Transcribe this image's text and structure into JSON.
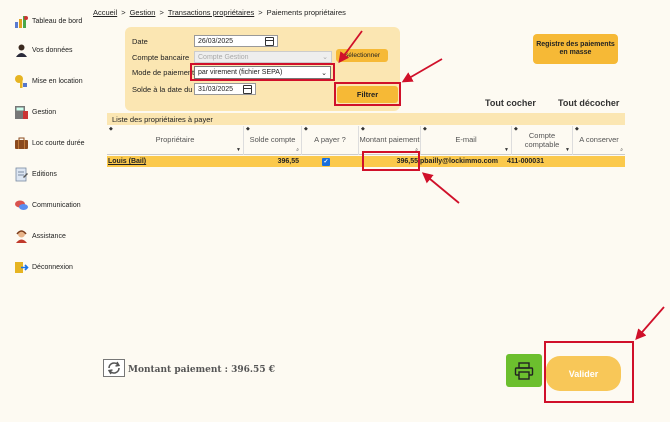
{
  "sidebar": {
    "items": [
      {
        "label": "Tableau de bord",
        "icon": "dashboard-icon"
      },
      {
        "label": "Vos données",
        "icon": "user-icon"
      },
      {
        "label": "Mise en location",
        "icon": "key-icon"
      },
      {
        "label": "Gestion",
        "icon": "calculator-icon"
      },
      {
        "label": "Loc courte durée",
        "icon": "suitcase-icon"
      },
      {
        "label": "Editions",
        "icon": "document-icon"
      },
      {
        "label": "Communication",
        "icon": "chat-icon"
      },
      {
        "label": "Assistance",
        "icon": "support-agent-icon"
      },
      {
        "label": "Déconnexion",
        "icon": "logout-icon"
      }
    ]
  },
  "breadcrumb": {
    "items": [
      "Accueil",
      "Gestion",
      "Transactions propriétaires"
    ],
    "current": "Paiements propriétaires",
    "separator": ">"
  },
  "filters": {
    "date_label": "Date",
    "date_value": "26/03/2025",
    "compte_label": "Compte bancaire",
    "compte_value": "Compte Gestion",
    "select_button": "Sélectionner",
    "mode_label": "Mode de paiement",
    "mode_value": "par virement (fichier SEPA)",
    "solde_label": "Solde à la date du",
    "solde_value": "31/03/2025",
    "filter_button": "Filtrer"
  },
  "registre_button": "Registre des paiements en masse",
  "tout_cocher": "Tout cocher",
  "tout_decocher": "Tout décocher",
  "table": {
    "title": "Liste des propriétaires à payer",
    "headers": [
      "Propriétaire",
      "Solde compte",
      "A payer ?",
      "Montant paiement",
      "E-mail",
      "Compte comptable",
      "A conserver"
    ],
    "rows": [
      {
        "proprietaire": "Louis (Bail)",
        "solde": "396,55",
        "a_payer": true,
        "montant": "396,55",
        "email": "pbailly@lockimmo.com",
        "compte": "411-000031",
        "conserver": ""
      }
    ]
  },
  "footer": {
    "montant_total": "Montant paiement : 396.55 €",
    "valider_button": "Valider"
  },
  "colors": {
    "accent": "#f6b936",
    "panel": "#fbe6b2",
    "row_highlight": "#fbc94c",
    "print_green": "#6cbf2e",
    "annotation_red": "#d0102a"
  }
}
